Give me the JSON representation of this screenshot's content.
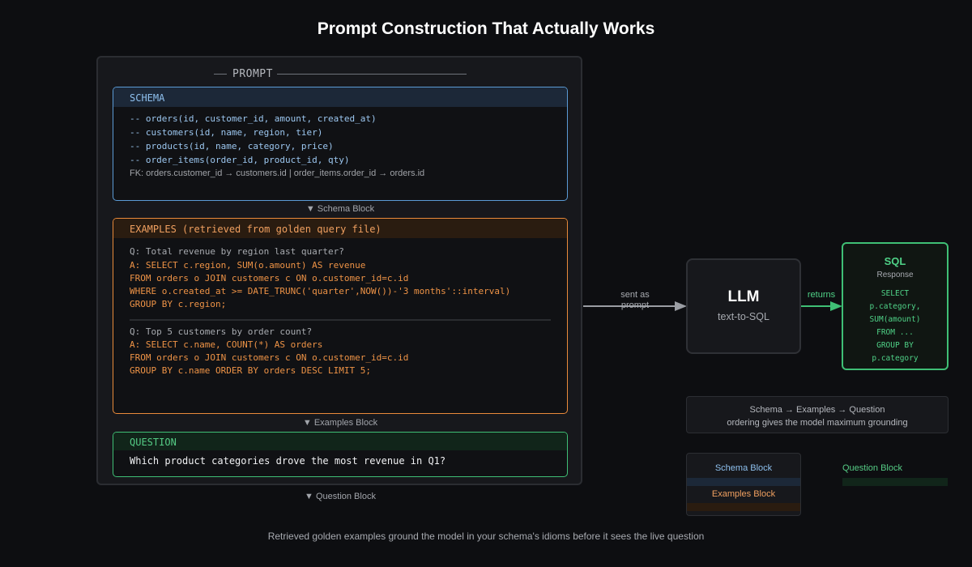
{
  "title": "Prompt Construction That Actually Works",
  "prompt_panel": {
    "label": "PROMPT"
  },
  "schema_block": {
    "header": "SCHEMA",
    "lines": [
      "-- orders(id, customer_id, amount, created_at)",
      "-- customers(id, name, region, tier)",
      "-- products(id, name, category, price)",
      "-- order_items(order_id, product_id, qty)"
    ],
    "fk": "FK: orders.customer_id → customers.id | order_items.order_id → orders.id",
    "caption": "▼ Schema Block"
  },
  "examples_block": {
    "header": "EXAMPLES (retrieved from golden query file)",
    "example1": {
      "q": "Q: Total revenue by region last quarter?",
      "a": [
        "A: SELECT c.region, SUM(o.amount) AS revenue",
        "FROM orders o JOIN customers c ON o.customer_id=c.id",
        "WHERE o.created_at >= DATE_TRUNC('quarter',NOW())-'3 months'::interval)",
        "GROUP BY c.region;"
      ]
    },
    "example2": {
      "q": "Q: Top 5 customers by order count?",
      "a": [
        "A: SELECT c.name, COUNT(*) AS orders",
        "FROM orders o JOIN customers c ON o.customer_id=c.id",
        "GROUP BY c.name ORDER BY orders DESC LIMIT 5;"
      ]
    },
    "caption": "▼ Examples Block"
  },
  "question_block": {
    "header": "QUESTION",
    "text": "Which product categories drove the most revenue in Q1?",
    "caption": "▼ Question Block"
  },
  "arrow_sent": {
    "label": "sent as prompt"
  },
  "llm": {
    "title": "LLM",
    "subtitle": "text-to-SQL"
  },
  "arrow_returns": {
    "label": "returns"
  },
  "sql_response": {
    "title": "SQL",
    "subtitle": "Response",
    "lines": [
      "SELECT",
      "p.category,",
      "SUM(amount)",
      "FROM ...",
      "GROUP BY",
      "p.category"
    ]
  },
  "note": {
    "line1": "Schema → Examples → Question",
    "line2": "ordering gives the model maximum grounding"
  },
  "legend": {
    "schema": "Schema Block",
    "examples": "Examples Block",
    "question": "Question Block"
  },
  "footer": "Retrieved golden examples ground the model in your schema's idioms before it sees the live question",
  "colors": {
    "schema": "#5b9bd5",
    "examples": "#e98a3a",
    "question": "#3fbf75",
    "background": "#0d0e11"
  }
}
